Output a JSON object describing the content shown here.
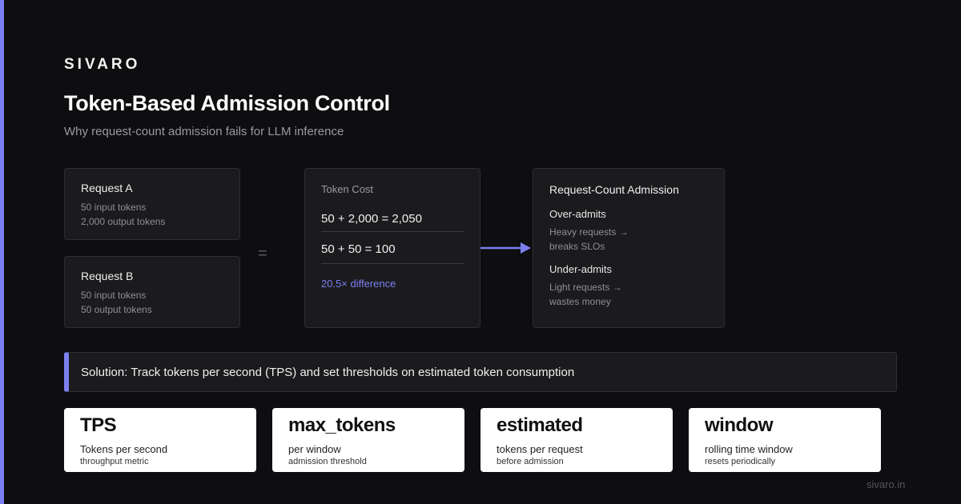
{
  "brand": "SIVARO",
  "title": "Token-Based Admission Control",
  "subtitle": "Why request-count admission fails for LLM inference",
  "colors": {
    "background": "#0e0e10",
    "accent": "#7c7ff0",
    "card": "#1b1b1e"
  },
  "requests": [
    {
      "title": "Request A",
      "input": "50 input tokens",
      "output": "2,000 output tokens"
    },
    {
      "title": "Request B",
      "input": "50 input tokens",
      "output": "50 output tokens"
    }
  ],
  "equals_symbol": "=",
  "token_cost": {
    "label": "Token Cost",
    "row_a": "50 + 2,000 = 2,050",
    "row_b": "50 + 50 = 100",
    "difference": "20.5× difference"
  },
  "request_count": {
    "title": "Request-Count Admission",
    "over": {
      "heading": "Over-admits",
      "line1": "Heavy requests →",
      "line2": "breaks SLOs"
    },
    "under": {
      "heading": "Under-admits",
      "line1": "Light requests →",
      "line2": "wastes money"
    }
  },
  "solution": "Solution: Track tokens per second (TPS) and set thresholds on estimated token consumption",
  "metrics": [
    {
      "name": "TPS",
      "desc": "Tokens per second",
      "sub": "throughput metric"
    },
    {
      "name": "max_tokens",
      "desc": "per window",
      "sub": "admission threshold"
    },
    {
      "name": "estimated",
      "desc": "tokens per request",
      "sub": "before admission"
    },
    {
      "name": "window",
      "desc": "rolling time window",
      "sub": "resets periodically"
    }
  ],
  "footer": "sivaro.in"
}
